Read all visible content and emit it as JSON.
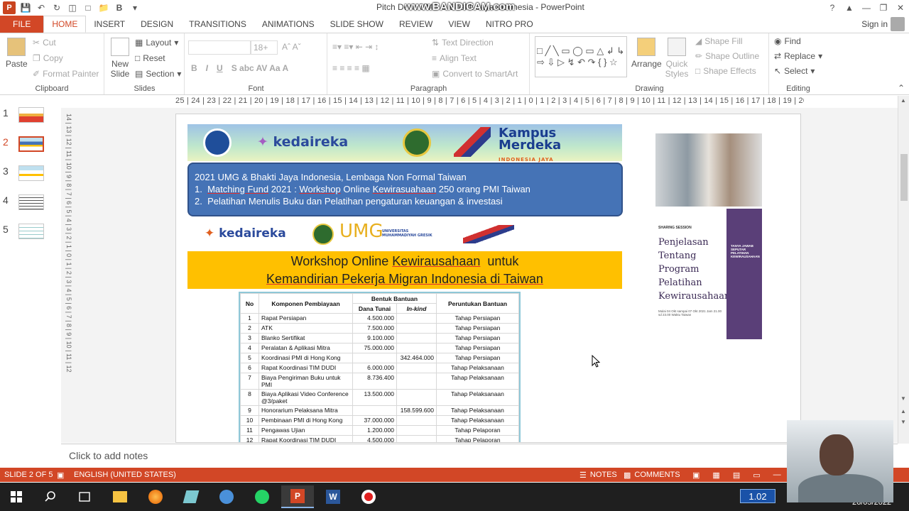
{
  "window": {
    "title": "Pitch Deck UMG & Bhakti Jaya Indonesia - PowerPoint",
    "watermark": "www.BANDICAM.com",
    "sign_in": "Sign in"
  },
  "tabs": [
    "FILE",
    "HOME",
    "INSERT",
    "DESIGN",
    "TRANSITIONS",
    "ANIMATIONS",
    "SLIDE SHOW",
    "REVIEW",
    "VIEW",
    "NITRO PRO"
  ],
  "active_tab": "HOME",
  "ribbon": {
    "clipboard": {
      "label": "Clipboard",
      "paste": "Paste",
      "cut": "Cut",
      "copy": "Copy",
      "format_painter": "Format Painter"
    },
    "slides": {
      "label": "Slides",
      "new_slide": "New Slide",
      "layout": "Layout",
      "reset": "Reset",
      "section": "Section"
    },
    "font": {
      "label": "Font",
      "size": "18+"
    },
    "paragraph": {
      "label": "Paragraph",
      "text_direction": "Text Direction",
      "align_text": "Align Text",
      "convert": "Convert to SmartArt"
    },
    "drawing": {
      "label": "Drawing",
      "arrange": "Arrange",
      "quick_styles": "Quick Styles",
      "shape_fill": "Shape Fill",
      "shape_outline": "Shape Outline",
      "shape_effects": "Shape Effects"
    },
    "editing": {
      "label": "Editing",
      "find": "Find",
      "replace": "Replace",
      "select": "Select"
    }
  },
  "ruler": {
    "horizontal": "25 | 24 | 23 | 22 | 21 | 20 | 19 | 18 | 17 | 16 | 15 | 14 | 13 | 12 | 11 | 10 | 9 | 8 | 7 | 6 | 5 | 4 | 3 | 2 | 1 | 0 | 1 | 2 | 3 | 4 | 5 | 6 | 7 | 8 | 9 | 10 | 11 | 12 | 13 | 14 | 15 | 16 | 17 | 18 | 19 | 20 | 21 | 22 | 23 | 24 | 25",
    "vertical": "14 | 13 | 12 | 11 | 10 | 9 | 8 | 7 | 6 | 5 | 4 | 3 | 2 | 1 | 0 | 1 | 2 | 3 | 4 | 5 | 6 | 7 | 8 | 9 | 10 | 11 | 12"
  },
  "thumbnails": [
    "1",
    "2",
    "3",
    "4",
    "5"
  ],
  "selected_slide": 2,
  "slide": {
    "logos_top": {
      "kedaireka": "kedaireka",
      "kampus": "Kampus Merdeka",
      "kampus_sub": "INDONESIA JAYA"
    },
    "blue_box": {
      "line1": "2021 UMG & Bhakti Jaya Indonesia, Lembaga Non Formal Taiwan",
      "line2_prefix": "1.  ",
      "line2_u1": "Matching Fund",
      "line2_mid": " 2021 : ",
      "line2_u2": "Workshop",
      "line2_mid2": " Online ",
      "line2_u3": "Kewirasuahaan",
      "line2_suffix": " 250 orang PMI Taiwan",
      "line3": "2.  Pelatihan Menulis Buku dan Pelatihan pengaturan keuangan & investasi"
    },
    "logos_row2": {
      "kedaireka": "kedaireka",
      "umg": "UMG",
      "umg_sub": "UNIVERSITAS MUHAMMADIYAH GRESIK"
    },
    "yellow": {
      "line1_a": "Workshop Online ",
      "line1_u": "Kewirausahaan",
      "line1_b": "  untuk",
      "line2_u": "Kemandirian Pekerja Migran Indonesia di Taiwan"
    },
    "table": {
      "headers": {
        "no": "No",
        "komponen": "Komponen Pembiayaan",
        "bentuk": "Bentuk Bantuan",
        "dana": "Dana Tunai",
        "inkind": "In-kind",
        "peruntukan": "Peruntukan Bantuan"
      },
      "rows": [
        {
          "no": "1",
          "item": "Rapat Persiapan",
          "dana": "4.500.000",
          "inkind": "",
          "untuk": "Tahap Persiapan"
        },
        {
          "no": "2",
          "item": "ATK",
          "dana": "7.500.000",
          "inkind": "",
          "untuk": "Tahap Persiapan"
        },
        {
          "no": "3",
          "item": "Blanko Sertifikat",
          "dana": "9.100.000",
          "inkind": "",
          "untuk": "Tahap Persiapan"
        },
        {
          "no": "4",
          "item": "Peralatan & Aplikasi Mitra",
          "dana": "75.000.000",
          "inkind": "",
          "untuk": "Tahap Persiapan"
        },
        {
          "no": "5",
          "item": "Koordinasi  PMI di Hong Kong",
          "dana": "",
          "inkind": "342.464.000",
          "untuk": "Tahap Persiapan"
        },
        {
          "no": "6",
          "item": "Rapat Koordinasi TIM DUDI",
          "dana": "6.000.000",
          "inkind": "",
          "untuk": "Tahap Pelaksanaan"
        },
        {
          "no": "7",
          "item": "Biaya Pengiriman Buku untuk PMI",
          "dana": "8.736.400",
          "inkind": "",
          "untuk": "Tahap Pelaksanaan"
        },
        {
          "no": "8",
          "item": "Biaya Aplikasi Video Conference @3/paket",
          "dana": "13.500.000",
          "inkind": "",
          "untuk": "Tahap Pelaksanaan"
        },
        {
          "no": "9",
          "item": "Honorarium Pelaksana Mitra",
          "dana": "",
          "inkind": "158.599.600",
          "untuk": "Tahap Pelaksanaan"
        },
        {
          "no": "10",
          "item": "Pembinaan PMI di Hong Kong",
          "dana": "37.000.000",
          "inkind": "",
          "untuk": "Tahap Pelaksanaan"
        },
        {
          "no": "11",
          "item": "Pengawas Ujian",
          "dana": "1.200.000",
          "inkind": "",
          "untuk": "Tahap Pelaporan"
        },
        {
          "no": "12",
          "item": "Rapat Koordinasi TIM DUDI",
          "dana": "4.500.000",
          "inkind": "",
          "untuk": "Tahap Pelaporan"
        }
      ]
    },
    "poster": {
      "session": "SHARING SESSION",
      "title": "Penjelasan Tentang Program Pelatihan Kewirausahaan",
      "date": "Mulai 04 Okt sampai 07 Okt 2021 Jam 21.00 sd 23.00 Waktu Taiwan",
      "side": "TANYA JAWAB SEPUTAR PELATIHAN KEWIRAUSAHAAN"
    }
  },
  "notes_placeholder": "Click to add notes",
  "status": {
    "slide": "SLIDE 2 OF 5",
    "language": "ENGLISH (UNITED STATES)",
    "notes": "NOTES",
    "comments": "COMMENTS"
  },
  "taskbar": {
    "zoom": "1.02",
    "date": "26/05/2022"
  },
  "colors": {
    "accent": "#d24726",
    "blue_box": "#4573b6",
    "yellow": "#ffc000"
  }
}
